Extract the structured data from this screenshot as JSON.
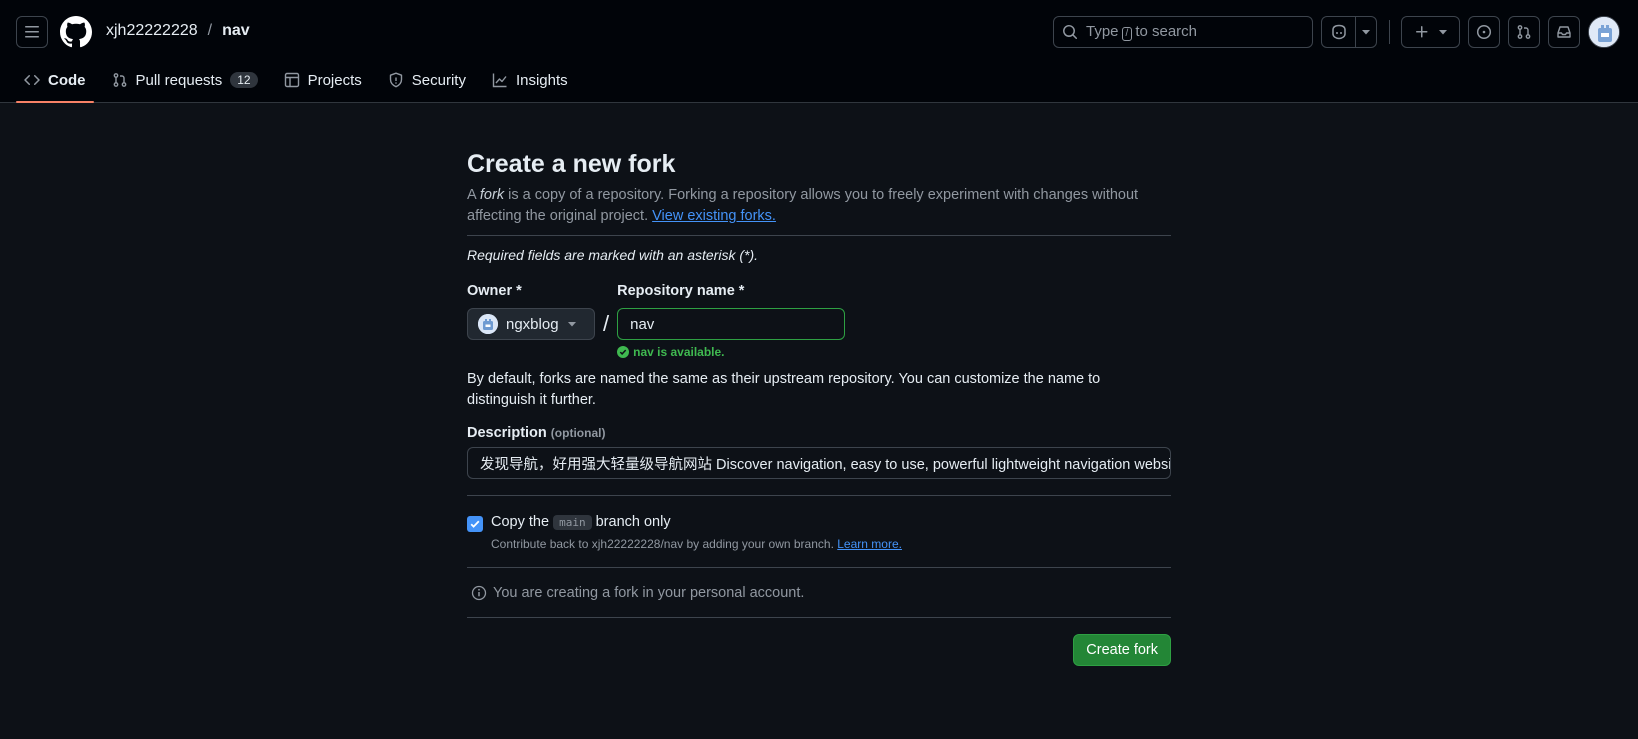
{
  "header": {
    "owner": "xjh22222228",
    "separator": "/",
    "repo": "nav",
    "search_prefix": "Type",
    "search_key": "/",
    "search_suffix": "to search"
  },
  "tabs": [
    {
      "label": "Code",
      "icon": "code-icon",
      "selected": true
    },
    {
      "label": "Pull requests",
      "icon": "git-pull-request-icon",
      "count": "12"
    },
    {
      "label": "Projects",
      "icon": "table-icon"
    },
    {
      "label": "Security",
      "icon": "shield-icon"
    },
    {
      "label": "Insights",
      "icon": "graph-icon"
    }
  ],
  "page": {
    "title": "Create a new fork",
    "lead_a": "A ",
    "lead_fork": "fork",
    "lead_b": " is a copy of a repository. Forking a repository allows you to freely experiment with changes without affecting the original project. ",
    "lead_link": "View existing forks.",
    "required_note": "Required fields are marked with an asterisk (*).",
    "owner_label": "Owner *",
    "owner_value": "ngxblog",
    "slash": "/",
    "repo_label": "Repository name *",
    "repo_value": "nav",
    "availability": "nav is available.",
    "default_note": "By default, forks are named the same as their upstream repository. You can customize the name to distinguish it further.",
    "description_label": "Description",
    "description_optional": "(optional)",
    "description_value": "发现导航，好用强大轻量级导航网站 Discover navigation, easy to use, powerful lightweight navigation website",
    "copy_label_a": "Copy the",
    "copy_branch": "main",
    "copy_label_b": "branch only",
    "copy_checked": true,
    "copy_note": "Contribute back to xjh22222228/nav by adding your own branch.",
    "copy_note_link": "Learn more.",
    "info": "You are creating a fork in your personal account.",
    "create_button": "Create fork"
  },
  "colors": {
    "background": "#0d1117",
    "header_bg": "#010409",
    "accent_link": "#4493f8",
    "success": "#3fb950",
    "primary_button": "#238636",
    "tab_underline": "#f78166"
  }
}
